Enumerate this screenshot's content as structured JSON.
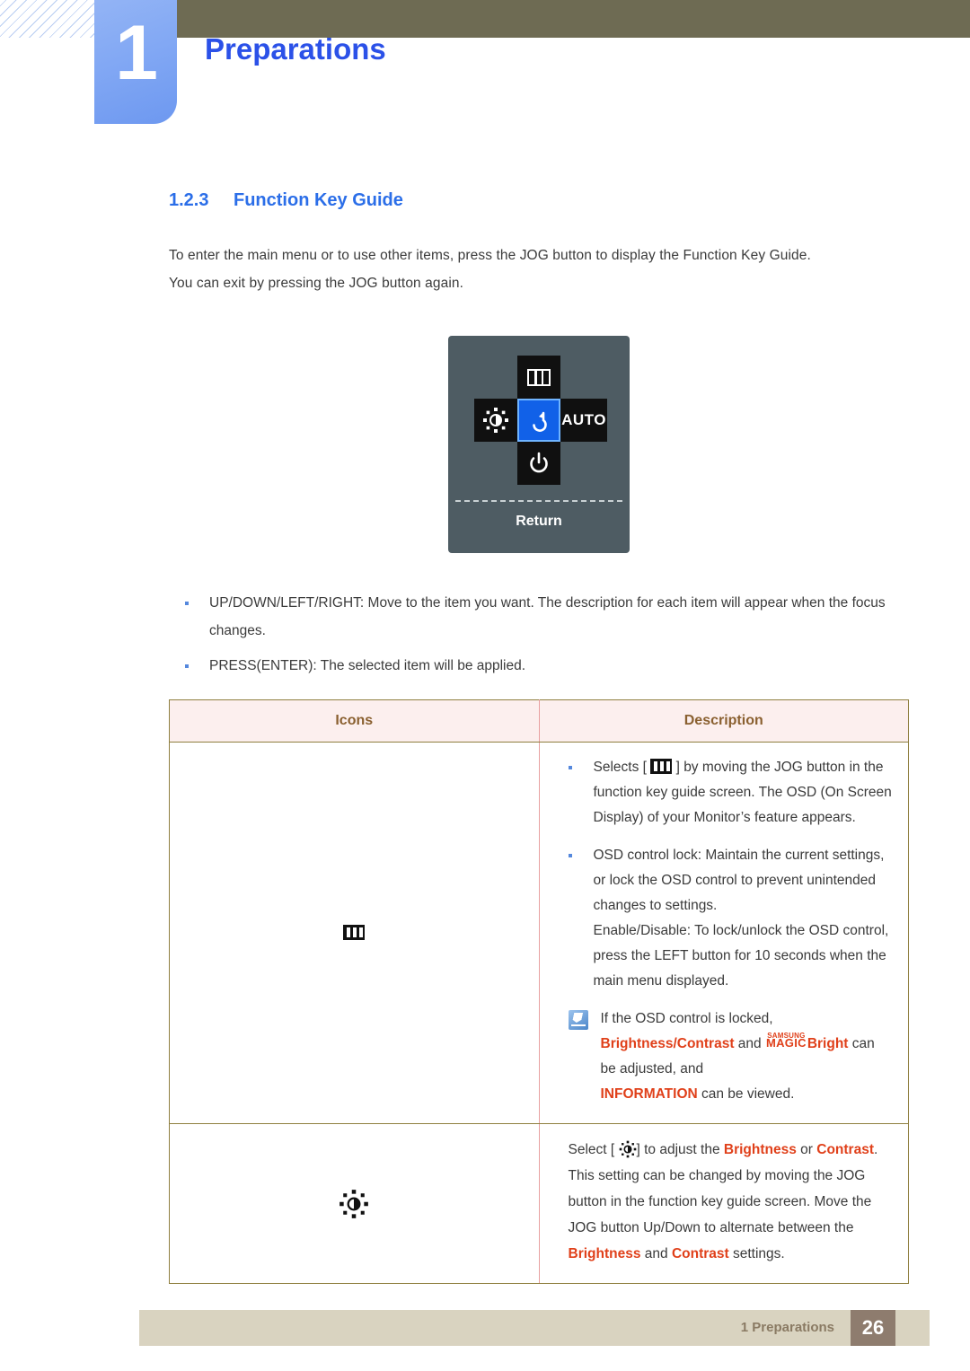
{
  "header": {
    "chapter_number": "1",
    "chapter_title": "Preparations"
  },
  "section": {
    "number": "1.2.3",
    "title": "Function Key Guide",
    "intro_line1": "To enter the main menu or to use other items, press the JOG button to display the Function Key Guide.",
    "intro_line2": "You can exit by pressing the JOG button again."
  },
  "osd": {
    "up_icon": "menu-icon",
    "left_icon": "brightness-icon",
    "center_icon": "return-arrow-icon",
    "right_label": "AUTO",
    "down_icon": "power-icon",
    "return_label": "Return",
    "colors": {
      "panel": "#4e5c63",
      "key": "#101010",
      "selected_key": "#1161e8",
      "selected_border": "#6fb4ff"
    }
  },
  "bullets": [
    "UP/DOWN/LEFT/RIGHT: Move to the item you want. The description for each item will appear when the focus changes.",
    "PRESS(ENTER): The selected item will be applied."
  ],
  "table": {
    "headers": [
      "Icons",
      "Description"
    ],
    "rows": [
      {
        "icon": "menu-icon",
        "bullet1_pre": "Selects [",
        "bullet1_post": "] by moving the JOG button in the function key guide screen. The OSD (On Screen Display) of your Monitor’s feature appears.",
        "bullet2": "OSD control lock: Maintain the current settings, or lock the OSD control to prevent unintended changes to settings.",
        "bullet2_sub": "Enable/Disable: To lock/unlock the OSD control, press the LEFT button for 10 seconds when the main menu displayed.",
        "note_line1": "If the OSD control is locked,",
        "note_line2_a": "Brightness/Contrast",
        "note_line2_b": " and ",
        "note_logo_top": "SAMSUNG",
        "note_logo_bottom": "MAGIC",
        "note_logo_suffix": "Bright",
        "note_line2_c": " can be adjusted, and ",
        "note_line3_a": "INFORMATION",
        "note_line3_b": " can be viewed."
      },
      {
        "icon": "brightness-icon",
        "line1_pre": "Select [",
        "line1_mid": "] to adjust the ",
        "line1_b1": "Brightness",
        "line1_or": " or ",
        "line1_b2": "Contrast",
        "line1_end": ".",
        "line2": "This setting can be changed by moving the JOG button in the function key guide screen. Move the JOG button Up/Down to alternate between the ",
        "line2_b1": "Brightness",
        "line2_and": " and ",
        "line2_b2": "Contrast",
        "line2_end": " settings."
      }
    ]
  },
  "footer": {
    "label": "1 Preparations",
    "page_number": "26"
  },
  "colors": {
    "accent_blue": "#2b51e8",
    "section_blue": "#2b6ee8",
    "brand_orange": "#e0401a",
    "olive": "#6e6b53",
    "footer_bar": "#d9d3c0",
    "page_box": "#8e7c6e"
  }
}
